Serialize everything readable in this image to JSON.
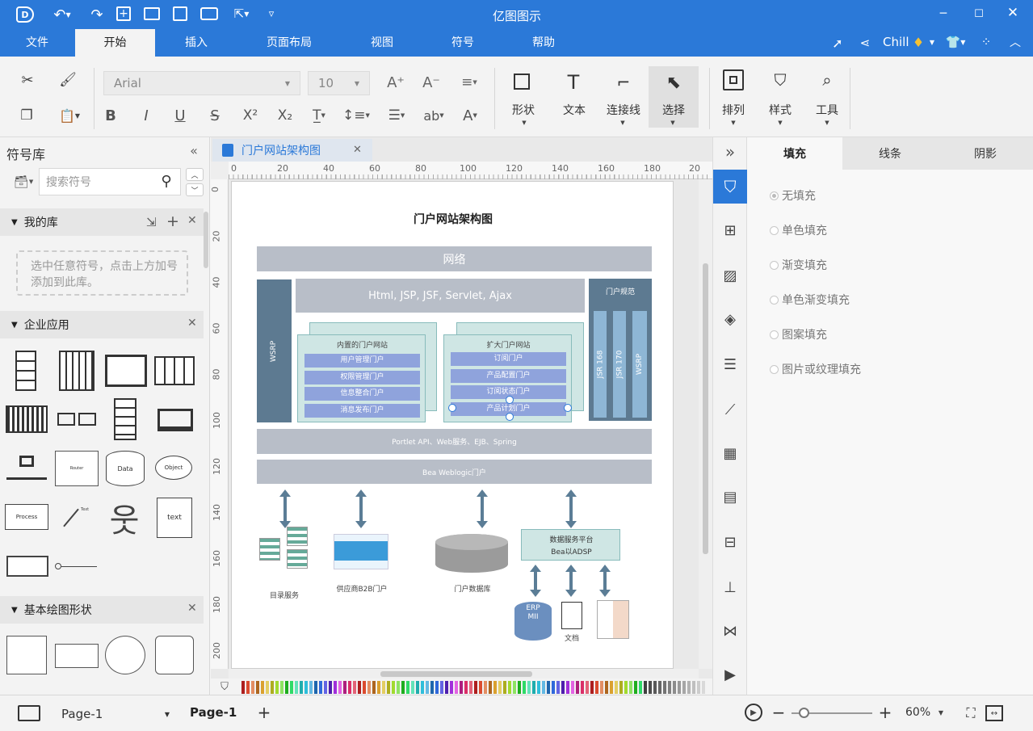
{
  "app": {
    "title": "亿图图示",
    "user": "Chill"
  },
  "menu": [
    "文件",
    "开始",
    "插入",
    "页面布局",
    "视图",
    "符号",
    "帮助"
  ],
  "ribbon": {
    "font_family": "Arial",
    "font_size": "10",
    "tools": [
      "形状",
      "文本",
      "连接线",
      "选择",
      "排列",
      "样式",
      "工具"
    ],
    "text_ab": "ab"
  },
  "left": {
    "title": "符号库",
    "search_placeholder": "搜索符号",
    "my_lib": "我的库",
    "my_lib_hint": "选中任意符号，点击上方加号添加到此库。",
    "enterprise": "企业应用",
    "basic": "基本绘图形状",
    "shape_texts": [
      "Data",
      "Object",
      "Process",
      "text",
      "Router",
      "Text"
    ]
  },
  "tab": {
    "title": "门户网站架构图"
  },
  "ruler": {
    "h": [
      "0",
      "20",
      "40",
      "60",
      "80",
      "100",
      "120",
      "140",
      "160",
      "180",
      "20"
    ],
    "v": [
      "0",
      "20",
      "40",
      "60",
      "80",
      "100",
      "120",
      "140",
      "160",
      "180",
      "200"
    ]
  },
  "diagram": {
    "title": "门户网站架构图",
    "network": "网络",
    "html_bar": "Html, JSP, JSF, Servlet, Ajax",
    "wsrp_left": "WSRP",
    "portal_spec": "门户规范",
    "jsr168": "JSR 168",
    "jsr170": "JSR 170",
    "wsrp_right": "WSRP",
    "inner_title": "内置的门户网站",
    "inner_items": [
      "用户管理门户",
      "权限管理门户",
      "信息整合门户",
      "消息发布门户"
    ],
    "ext_title": "扩大门户网站",
    "ext_items": [
      "订阅门户",
      "产品配置门户",
      "订阅状态门户",
      "产品计划门户"
    ],
    "portlet": "Portlet API、Web服务、EJB、Spring",
    "weblogic": "Bea Weblogic门户",
    "dataservice_1": "数据服务平台",
    "dataservice_2": "Bea以ADSP",
    "erp_1": "ERP",
    "erp_2": "MII",
    "labels": {
      "catalog": "目录服务",
      "supplier": "供应商B2B门户",
      "db": "门户数据库",
      "doc": "文档"
    }
  },
  "right": {
    "tabs": [
      "填充",
      "线条",
      "阴影"
    ],
    "options": [
      "无填充",
      "单色填充",
      "渐变填充",
      "单色渐变填充",
      "图案填充",
      "图片或纹理填充"
    ]
  },
  "status": {
    "page_select": "Page-1",
    "page_tab": "Page-1",
    "zoom": "60%"
  },
  "colors": {
    "accent": "#2b79d8",
    "diagram_block": "#b8bec8",
    "diagram_dark": "#5d7a91",
    "diagram_teal": "#cfe6e4",
    "diagram_purple": "#8fa3dc"
  }
}
